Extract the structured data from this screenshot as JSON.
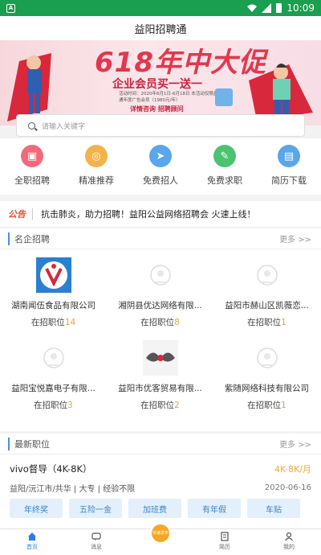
{
  "status_bar": {
    "time": "10:09"
  },
  "app_title": "益阳招聘通",
  "banner": {
    "headline": "618年中大促",
    "subtitle": "企业会员买一送一",
    "fine_print": "活动时间：2020年6月1日-6月18日 本活动仅限益阳招聘通年度广告会员（1980元/年）",
    "cta": "详情咨询 招聘顾问"
  },
  "search": {
    "placeholder": "请输入关键字"
  },
  "shortcuts": [
    {
      "label": "全职招聘",
      "icon": "briefcase-icon",
      "color": "#f26a7a"
    },
    {
      "label": "精准推荐",
      "icon": "target-icon",
      "color": "#f4b24a"
    },
    {
      "label": "免费招人",
      "icon": "paper-plane-icon",
      "color": "#5aa6ea"
    },
    {
      "label": "免费求职",
      "icon": "edit-icon",
      "color": "#4cc36f"
    },
    {
      "label": "简历下载",
      "icon": "resume-icon",
      "color": "#5aa6ea"
    }
  ],
  "notice": {
    "tag": "公告",
    "text": "抗击肺炎，助力招聘！益阳公益网络招聘会 火速上线！"
  },
  "featured": {
    "title": "名企招聘",
    "more": "更多 >>",
    "prefix": "在招职位",
    "companies": [
      {
        "name": "湖南闻伍食品有限公司",
        "count": "14",
        "logo": "red-logo"
      },
      {
        "name": "湘阴县优达网络有限...",
        "count": "8",
        "logo": "placeholder-logo"
      },
      {
        "name": "益阳市赫山区凯薇恋...",
        "count": "1",
        "logo": "placeholder-logo"
      },
      {
        "name": "益阳宝悦嘉电子有限...",
        "count": "3",
        "logo": "placeholder-logo"
      },
      {
        "name": "益阳市优客贸易有限...",
        "count": "2",
        "logo": "wing-logo"
      },
      {
        "name": "紫随网络科技有限公司",
        "count": "1",
        "logo": "placeholder-logo"
      }
    ]
  },
  "latest": {
    "title": "最新职位",
    "more": "更多 >>",
    "jobs": [
      {
        "title": "vivo督导（4K-8K）",
        "salary": "4K-8K/月",
        "meta": "益阳/沅江市/共华 | 大专 | 经验不限",
        "date": "2020-06-16",
        "tags": [
          "年终奖",
          "五险一金",
          "加班费",
          "有年假",
          "车贴"
        ]
      }
    ]
  },
  "tabbar": [
    {
      "label": "首页",
      "icon": "home-icon"
    },
    {
      "label": "消息",
      "icon": "message-icon"
    },
    {
      "label": "",
      "icon": "publish-icon"
    },
    {
      "label": "简历",
      "icon": "resume-icon"
    },
    {
      "label": "我的",
      "icon": "user-icon"
    }
  ],
  "center_button": "快速发布"
}
